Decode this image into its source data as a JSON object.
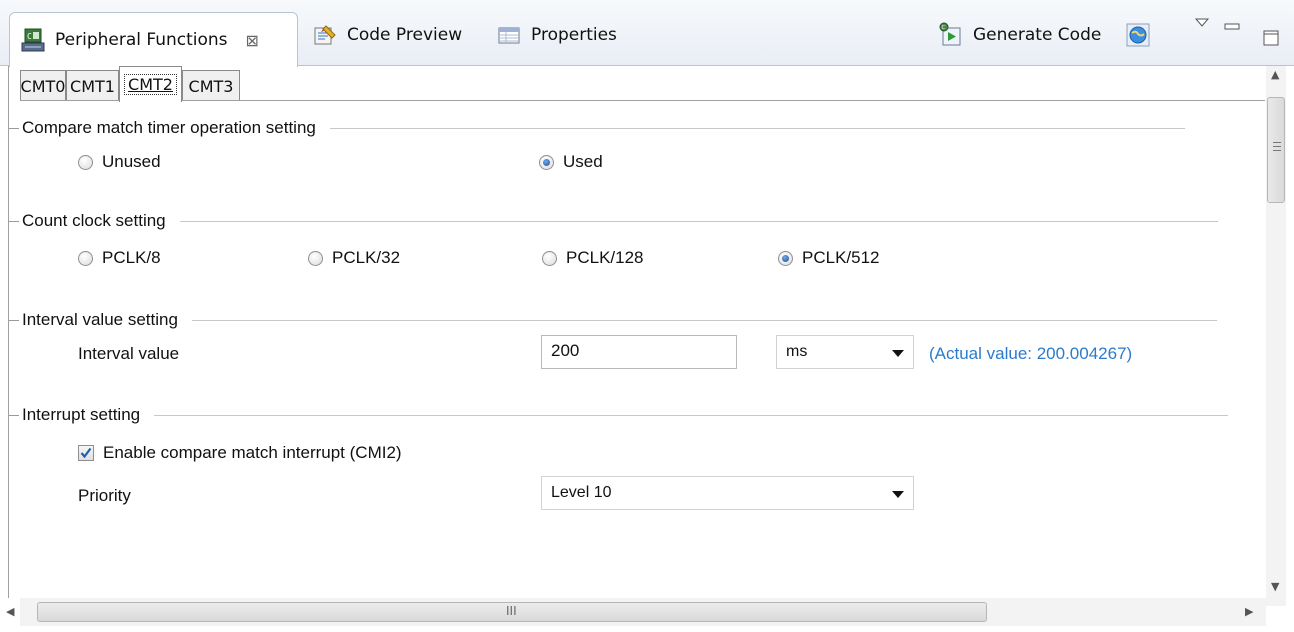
{
  "view_tabs": [
    {
      "label": "Peripheral Functions",
      "icon": "peripheral-functions-icon",
      "active": true
    },
    {
      "label": "Code Preview",
      "icon": "code-preview-icon",
      "active": false
    },
    {
      "label": "Properties",
      "icon": "properties-icon",
      "active": false
    }
  ],
  "toolbar": {
    "generate_code_label": "Generate Code",
    "close_glyph": "⊠"
  },
  "peripheral_tabs": [
    "CMT0",
    "CMT1",
    "CMT2",
    "CMT3"
  ],
  "selected_peripheral_tab": "CMT2",
  "groups": {
    "operation": {
      "title": "Compare match timer operation setting",
      "options": [
        "Unused",
        "Used"
      ],
      "selected": "Used"
    },
    "count_clock": {
      "title": "Count clock setting",
      "options": [
        "PCLK/8",
        "PCLK/32",
        "PCLK/128",
        "PCLK/512"
      ],
      "selected": "PCLK/512"
    },
    "interval": {
      "title": "Interval value setting",
      "label": "Interval value",
      "value": "200",
      "unit": "ms",
      "actual": "(Actual value: 200.004267)"
    },
    "interrupt": {
      "title": "Interrupt setting",
      "enable_label": "Enable compare match interrupt (CMI2)",
      "enable_checked": true,
      "priority_label": "Priority",
      "priority_value": "Level 10"
    }
  },
  "scroll": {
    "hscroll_grip": "III"
  },
  "colors": {
    "actual_value": "#2a7bd0",
    "radio_selected": "#1e4f9a",
    "check_mark": "#1f5fb0"
  }
}
